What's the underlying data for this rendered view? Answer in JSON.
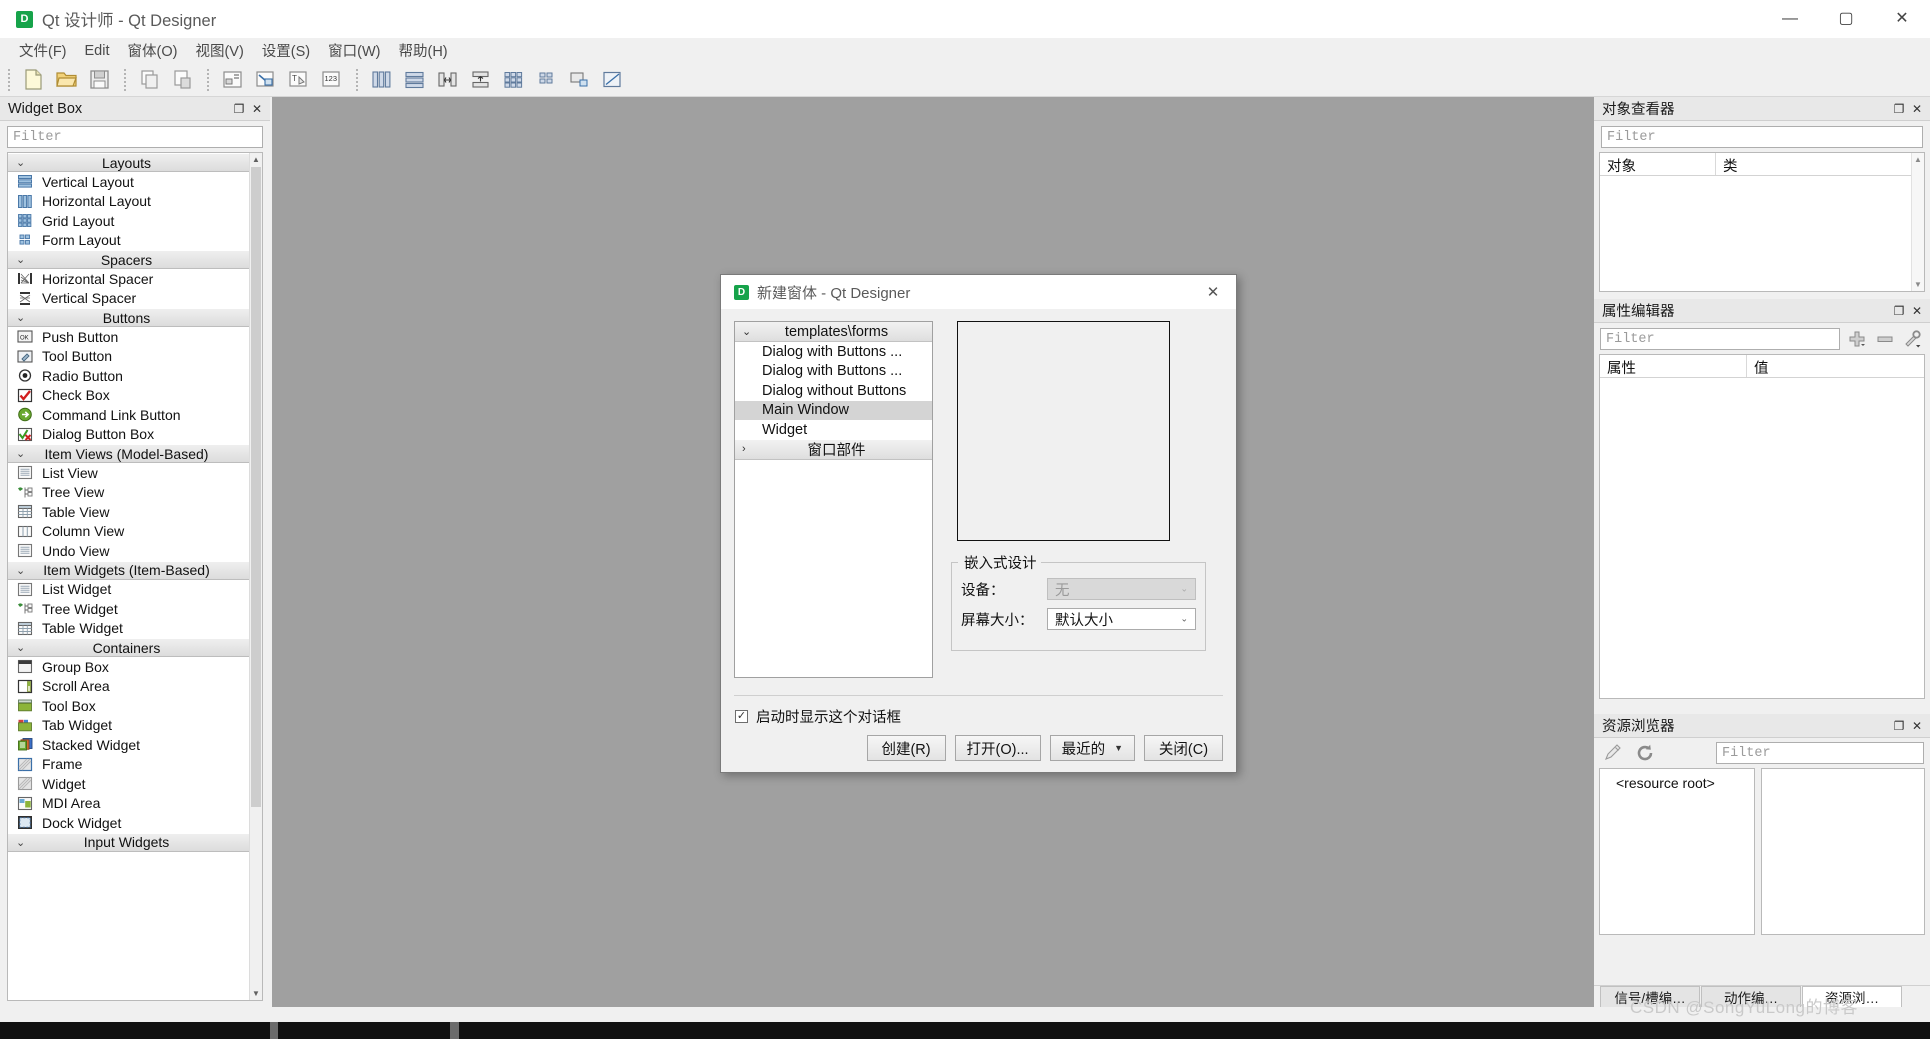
{
  "window": {
    "title": "Qt 设计师 - Qt Designer",
    "icon_letter": "D",
    "minimize": "—",
    "maximize": "▢",
    "close": "✕"
  },
  "menubar": {
    "items": [
      {
        "label": "文件(F)"
      },
      {
        "label": "Edit"
      },
      {
        "label": "窗体(O)"
      },
      {
        "label": "视图(V)"
      },
      {
        "label": "设置(S)"
      },
      {
        "label": "窗口(W)"
      },
      {
        "label": "帮助(H)"
      }
    ]
  },
  "toolbar": {
    "groups": [
      {
        "icons": [
          "new-file-icon",
          "open-folder-icon",
          "save-icon"
        ]
      },
      {
        "icons": [
          "copy-icon",
          "paste-icon"
        ]
      },
      {
        "icons": [
          "edit-widgets-icon",
          "edit-signals-slots-icon",
          "edit-buddies-icon",
          "edit-tab-order-icon"
        ]
      },
      {
        "icons": [
          "layout-horizontal-icon",
          "layout-vertical-icon",
          "layout-splitter-h-icon",
          "layout-splitter-v-icon",
          "layout-grid-icon",
          "layout-form-icon",
          "break-layout-icon",
          "adjust-size-icon"
        ]
      }
    ]
  },
  "widget_box": {
    "title": "Widget Box",
    "float_button": "❐",
    "close_button": "✕",
    "filter_placeholder": "Filter",
    "categories": [
      {
        "name": "Layouts",
        "expanded": true,
        "items": [
          {
            "label": "Vertical Layout",
            "icon": "vertical-layout-icon"
          },
          {
            "label": "Horizontal Layout",
            "icon": "horizontal-layout-icon"
          },
          {
            "label": "Grid Layout",
            "icon": "grid-layout-icon"
          },
          {
            "label": "Form Layout",
            "icon": "form-layout-icon"
          }
        ]
      },
      {
        "name": "Spacers",
        "expanded": true,
        "items": [
          {
            "label": "Horizontal Spacer",
            "icon": "horizontal-spacer-icon"
          },
          {
            "label": "Vertical Spacer",
            "icon": "vertical-spacer-icon"
          }
        ]
      },
      {
        "name": "Buttons",
        "expanded": true,
        "items": [
          {
            "label": "Push Button",
            "icon": "push-button-icon"
          },
          {
            "label": "Tool Button",
            "icon": "tool-button-icon"
          },
          {
            "label": "Radio Button",
            "icon": "radio-button-icon"
          },
          {
            "label": "Check Box",
            "icon": "check-box-icon"
          },
          {
            "label": "Command Link Button",
            "icon": "command-link-button-icon"
          },
          {
            "label": "Dialog Button Box",
            "icon": "dialog-button-box-icon"
          }
        ]
      },
      {
        "name": "Item Views (Model-Based)",
        "expanded": true,
        "items": [
          {
            "label": "List View",
            "icon": "list-view-icon"
          },
          {
            "label": "Tree View",
            "icon": "tree-view-icon"
          },
          {
            "label": "Table View",
            "icon": "table-view-icon"
          },
          {
            "label": "Column View",
            "icon": "column-view-icon"
          },
          {
            "label": "Undo View",
            "icon": "undo-view-icon"
          }
        ]
      },
      {
        "name": "Item Widgets (Item-Based)",
        "expanded": true,
        "items": [
          {
            "label": "List Widget",
            "icon": "list-widget-icon"
          },
          {
            "label": "Tree Widget",
            "icon": "tree-widget-icon"
          },
          {
            "label": "Table Widget",
            "icon": "table-widget-icon"
          }
        ]
      },
      {
        "name": "Containers",
        "expanded": true,
        "items": [
          {
            "label": "Group Box",
            "icon": "group-box-icon"
          },
          {
            "label": "Scroll Area",
            "icon": "scroll-area-icon"
          },
          {
            "label": "Tool Box",
            "icon": "tool-box-icon"
          },
          {
            "label": "Tab Widget",
            "icon": "tab-widget-icon"
          },
          {
            "label": "Stacked Widget",
            "icon": "stacked-widget-icon"
          },
          {
            "label": "Frame",
            "icon": "frame-icon"
          },
          {
            "label": "Widget",
            "icon": "widget-icon"
          },
          {
            "label": "MDI Area",
            "icon": "mdi-area-icon"
          },
          {
            "label": "Dock Widget",
            "icon": "dock-widget-icon"
          }
        ]
      },
      {
        "name": "Input Widgets",
        "expanded": true,
        "items": []
      }
    ]
  },
  "object_inspector": {
    "title": "对象查看器",
    "float_button": "❐",
    "close_button": "✕",
    "filter_placeholder": "Filter",
    "columns": [
      "对象",
      "类"
    ],
    "rows": []
  },
  "property_editor": {
    "title": "属性编辑器",
    "float_button": "❐",
    "close_button": "✕",
    "filter_placeholder": "Filter",
    "add_icon": "plus-icon",
    "remove_icon": "minus-icon",
    "configure_icon": "wrench-icon",
    "columns": [
      "属性",
      "值"
    ],
    "rows": []
  },
  "resource_browser": {
    "title": "资源浏览器",
    "float_button": "❐",
    "close_button": "✕",
    "edit_icon": "pencil-icon",
    "reload_icon": "refresh-icon",
    "filter_placeholder": "Filter",
    "tree_root": "<resource root>"
  },
  "bottom_tabs": [
    {
      "label": "信号/槽编…",
      "active": false
    },
    {
      "label": "动作编…",
      "active": false
    },
    {
      "label": "资源浏…",
      "active": true
    }
  ],
  "new_form_dialog": {
    "icon_letter": "D",
    "title": "新建窗体 - Qt Designer",
    "close_button": "✕",
    "template_tree": [
      {
        "name": "templates\\forms",
        "expanded": true,
        "items": [
          {
            "label": "Dialog with Buttons ...",
            "selected": false
          },
          {
            "label": "Dialog with Buttons ...",
            "selected": false
          },
          {
            "label": "Dialog without Buttons",
            "selected": false
          },
          {
            "label": "Main Window",
            "selected": true
          },
          {
            "label": "Widget",
            "selected": false
          }
        ]
      },
      {
        "name": "窗口部件",
        "expanded": false,
        "items": []
      }
    ],
    "embedded_group": {
      "legend": "嵌入式设计",
      "device_label": "设备：",
      "device_value": "无",
      "device_disabled": true,
      "screen_label": "屏幕大小：",
      "screen_value": "默认大小",
      "screen_disabled": false,
      "dropdown_arrow": "⌄"
    },
    "show_on_startup": {
      "label": "启动时显示这个对话框",
      "checked": true,
      "check_glyph": "✓"
    },
    "buttons": [
      {
        "label": "创建(R)",
        "has_dropdown": false
      },
      {
        "label": "打开(O)...",
        "has_dropdown": false
      },
      {
        "label": "最近的",
        "has_dropdown": true,
        "dropdown_glyph": "▼"
      },
      {
        "label": "关闭(C)",
        "has_dropdown": false
      }
    ]
  },
  "watermark": "CSDN @SongYuLong的博客",
  "colors": {
    "canvas": "#a0a0a0",
    "chrome": "#f0f0f0",
    "accent_green": "#16a34a",
    "selection": "#d4d4d4"
  }
}
